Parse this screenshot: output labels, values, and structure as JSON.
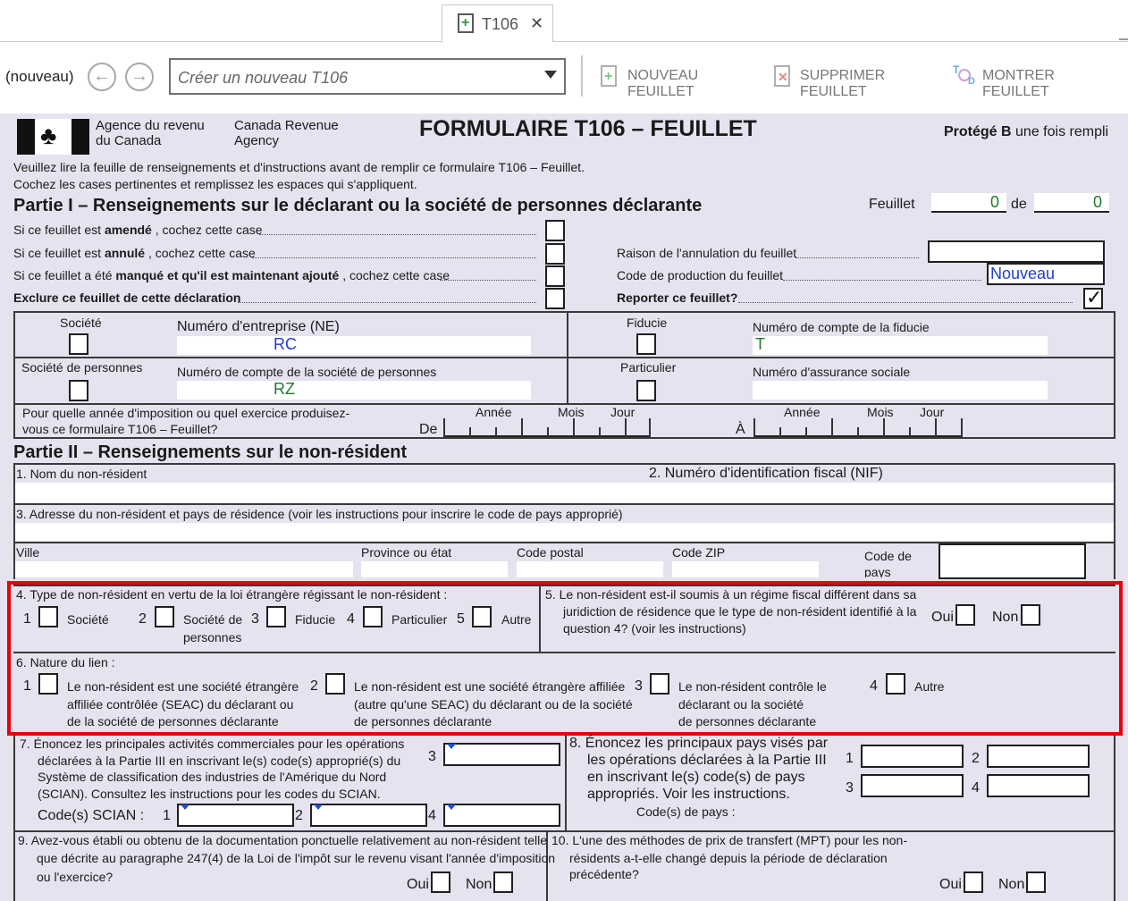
{
  "tab": {
    "title": "T106",
    "close": "✕"
  },
  "toolbar": {
    "status": "(nouveau)",
    "combo_placeholder": "Créer un nouveau T106",
    "new_sheet": "NOUVEAU FEUILLET",
    "delete_sheet": "SUPPRIMER FEUILLET",
    "show_sheet": "MONTRER FEUILLET"
  },
  "header": {
    "agency_fr_1": "Agence du revenu",
    "agency_fr_2": "du Canada",
    "agency_en_1": "Canada Revenue",
    "agency_en_2": "Agency",
    "form_title": "FORMULAIRE T106 – FEUILLET",
    "protected_bold": "Protégé B",
    "protected_rest": " une fois rempli",
    "instr_1": "Veuillez lire la feuille de renseignements et d'instructions avant de remplir ce formulaire T106 – Feuillet.",
    "instr_2": "Cochez les cases pertinentes et remplissez les espaces qui s'appliquent."
  },
  "part1": {
    "title": "Partie I – Renseignements sur le déclarant ou la société de personnes déclarante",
    "sheet_label": "Feuillet",
    "sheet_num": "0",
    "of_label": "de",
    "sheet_total": "0",
    "amended_pre": "Si ce feuillet est ",
    "amended_bold": "amendé",
    "amended_post": " , cochez cette case",
    "cancelled_pre": "Si ce feuillet est ",
    "cancelled_bold": "annulé",
    "cancelled_post": " , cochez cette case",
    "missed_pre": "Si ce feuillet a été ",
    "missed_bold": "manqué et qu'il est maintenant ajouté",
    "missed_post": " , cochez cette case",
    "exclude": "Exclure ce feuillet de cette déclaration",
    "cancel_reason": "Raison de l'annulation du feuillet",
    "prod_code": "Code de production du feuillet",
    "prod_code_value": "Nouveau",
    "carry": "Reporter ce feuillet?",
    "carry_mark": "✓",
    "societe": "Société",
    "ne_label": "Numéro d'entreprise (NE)",
    "ne_value": "RC",
    "fiducie": "Fiducie",
    "trust_label": "Numéro de compte de la fiducie",
    "trust_value": "T",
    "partnership": "Société de personnes",
    "partner_acct": "Numéro de compte de la société de personnes",
    "partner_value": "RZ",
    "particulier": "Particulier",
    "sin": "Numéro d'assurance sociale",
    "year_q1": "Pour quelle année d'imposition ou quel exercice produisez-",
    "year_q2": "vous ce formulaire T106 – Feuillet?",
    "de": "De",
    "a": "À",
    "annee": "Année",
    "mois": "Mois",
    "jour": "Jour"
  },
  "part2": {
    "title": "Partie II – Renseignements sur le non-résident",
    "name": "1. Nom du non-résident",
    "nif": "2. Numéro d'identification fiscal (NIF)",
    "address": "3. Adresse du non-résident et pays de résidence (voir les instructions pour inscrire le code de pays approprié)",
    "ville": "Ville",
    "province": "Province ou état",
    "postal": "Code postal",
    "zip": "Code ZIP",
    "country_1": "Code de",
    "country_2": "pays",
    "q4": "4. Type de non-résident en vertu de la loi étrangère régissant le non-résident :",
    "q4_opts": [
      "Société",
      "Société de",
      "personnes",
      "Fiducie",
      "Particulier",
      "Autre"
    ],
    "q4_nums": [
      "1",
      "2",
      "3",
      "4",
      "5"
    ],
    "q5_1": "5.   Le non-résident est-il soumis à un régime fiscal différent dans sa",
    "q5_2": "juridiction de résidence que le type de non-résident identifié à la",
    "q5_3": "question 4? (voir les instructions)",
    "oui": "Oui",
    "non": "Non",
    "q6": "6. Nature du lien :",
    "q6_o1": [
      "Le non-résident est une société étrangère",
      "affiliée contrôlée (SEAC) du déclarant ou",
      "de la société de personnes déclarante"
    ],
    "q6_o2": [
      "Le non-résident est une société étrangère affiliée",
      "(autre qu'une SEAC) du déclarant ou de la société",
      "de personnes déclarante"
    ],
    "q6_o3": [
      "Le non-résident contrôle le",
      "déclarant ou la société",
      "de personnes déclarante"
    ],
    "q6_o4": "Autre",
    "q6_nums": [
      "1",
      "2",
      "3",
      "4"
    ],
    "q7": [
      "7.   Énoncez les principales activités commerciales pour les opérations",
      "déclarées à la Partie III en inscrivant le(s) code(s) approprié(s) du",
      "Système de classification des industries de l'Amérique du Nord",
      "(SCIAN). Consultez les instructions pour les codes du SCIAN."
    ],
    "scian": "Code(s) SCIAN :",
    "q8": [
      "8.  Énoncez les principaux pays visés par",
      "les opérations déclarées à la Partie III",
      "en inscrivant le(s) code(s) de pays",
      "appropriés. Voir les instructions."
    ],
    "pays_codes": "Code(s) de pays :",
    "q9": [
      "9.   Avez-vous établi ou obtenu de la documentation ponctuelle relativement au non-résident telle",
      "que décrite au paragraphe 247(4) de la Loi de l'impôt sur le revenu visant l'année d'imposition",
      "ou l'exercice?"
    ],
    "q10": [
      "10.  L'une des méthodes de prix de transfert (MPT) pour les non-",
      "résidents a-t-elle changé depuis la période de déclaration",
      "précédente?"
    ]
  },
  "colors": {
    "form_bg": "#e6e2ef",
    "highlight": "#e8000b",
    "blue_value": "#1f3fd0",
    "green_value": "#1e7a2e"
  }
}
